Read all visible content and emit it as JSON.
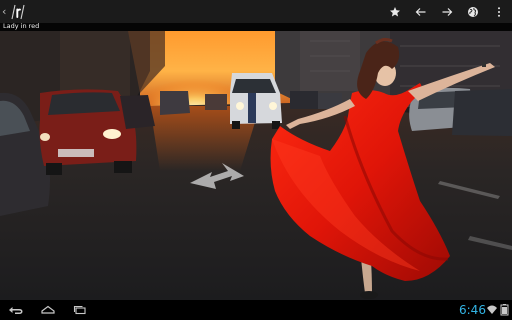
{
  "app": {
    "logo_icon": "reddit-r-logo-icon",
    "up_icon": "chevron-left-icon"
  },
  "action_bar": {
    "buttons": [
      {
        "name": "favorite",
        "icon": "star-icon"
      },
      {
        "name": "previous",
        "icon": "arrow-left-icon"
      },
      {
        "name": "next",
        "icon": "arrow-right-icon"
      },
      {
        "name": "open-browser",
        "icon": "globe-icon"
      },
      {
        "name": "overflow",
        "icon": "overflow-menu-icon"
      }
    ]
  },
  "image": {
    "title": "Lady in red",
    "description_icon": "photo"
  },
  "system_bar": {
    "clock": "6:46",
    "nav": [
      "back-icon",
      "home-icon",
      "recent-apps-icon"
    ],
    "status_icons": [
      "wifi-icon",
      "battery-icon"
    ],
    "clock_color": "#33b5e5"
  },
  "colors": {
    "action_bar_bg": "#1b1b1b",
    "dress_red": "#e01508",
    "sunset_orange": "#ff7a10"
  }
}
